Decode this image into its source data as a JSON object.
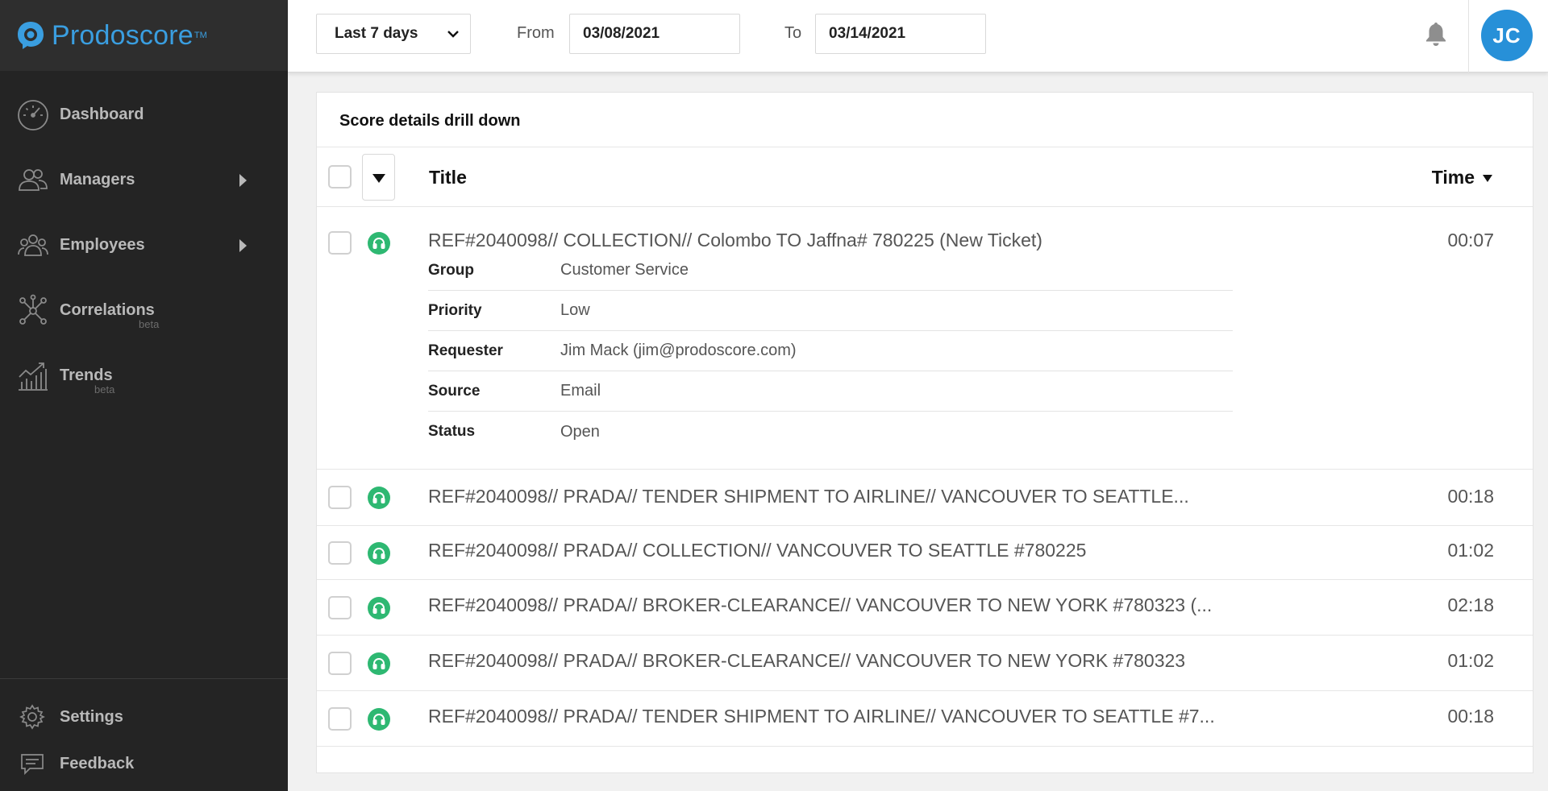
{
  "app": {
    "name": "Prodoscore",
    "trademark": "TM"
  },
  "sidebar": {
    "items": [
      {
        "label": "Dashboard",
        "icon": "gauge-icon",
        "has_submenu": false,
        "beta": ""
      },
      {
        "label": "Managers",
        "icon": "managers-icon",
        "has_submenu": true,
        "beta": ""
      },
      {
        "label": "Employees",
        "icon": "employees-icon",
        "has_submenu": true,
        "beta": ""
      },
      {
        "label": "Correlations",
        "icon": "network-icon",
        "has_submenu": false,
        "beta": "beta"
      },
      {
        "label": "Trends",
        "icon": "trends-icon",
        "has_submenu": false,
        "beta": "beta"
      }
    ],
    "bottom": [
      {
        "label": "Settings",
        "icon": "gear-icon"
      },
      {
        "label": "Feedback",
        "icon": "feedback-icon"
      }
    ]
  },
  "topbar": {
    "range_value": "Last 7 days",
    "from_label": "From",
    "from_value": "03/08/2021",
    "to_label": "To",
    "to_value": "03/14/2021",
    "avatar_initials": "JC"
  },
  "card": {
    "title": "Score details drill down",
    "columns": {
      "title": "Title",
      "time": "Time"
    },
    "expanded_row": {
      "title": "REF#2040098// COLLECTION// Colombo TO Jaffna# 780225 (New Ticket)",
      "time": "00:07",
      "details": [
        {
          "key": "Group",
          "value": "Customer Service"
        },
        {
          "key": "Priority",
          "value": "Low"
        },
        {
          "key": "Requester",
          "value": "Jim Mack (jim@prodoscore.com)"
        },
        {
          "key": "Source",
          "value": "Email"
        },
        {
          "key": "Status",
          "value": "Open"
        }
      ]
    },
    "rows": [
      {
        "title": "REF#2040098// PRADA// TENDER SHIPMENT TO AIRLINE// VANCOUVER TO SEATTLE...",
        "time": "00:18"
      },
      {
        "title": "REF#2040098// PRADA// COLLECTION// VANCOUVER TO SEATTLE #780225",
        "time": "01:02"
      },
      {
        "title": "REF#2040098// PRADA// BROKER-CLEARANCE// VANCOUVER TO NEW YORK #780323 (...",
        "time": "02:18"
      },
      {
        "title": "REF#2040098// PRADA// BROKER-CLEARANCE// VANCOUVER TO NEW YORK #780323",
        "time": "01:02"
      },
      {
        "title": "REF#2040098// PRADA// TENDER SHIPMENT TO AIRLINE// VANCOUVER TO SEATTLE #7...",
        "time": "00:18"
      }
    ]
  },
  "colors": {
    "sidebar_bg": "#242424",
    "logo_bar_bg": "#2e2e2e",
    "brand_blue": "#3a9ee0",
    "avatar_blue": "#2790d8",
    "headset_green": "#2eb872"
  }
}
